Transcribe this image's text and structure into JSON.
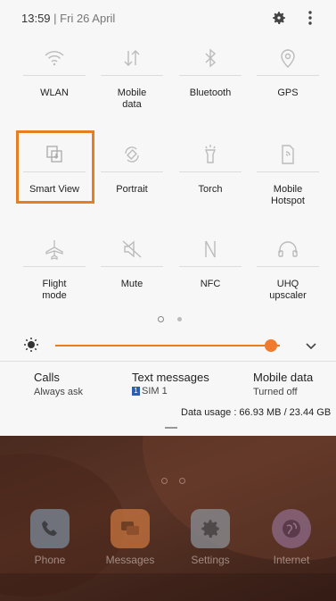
{
  "status": {
    "time": "13:59",
    "date": "Fri 26 April"
  },
  "tiles": [
    {
      "label": "WLAN",
      "icon": "wifi-icon"
    },
    {
      "label": "Mobile\ndata",
      "icon": "mobile-data-icon"
    },
    {
      "label": "Bluetooth",
      "icon": "bluetooth-icon"
    },
    {
      "label": "GPS",
      "icon": "location-pin-icon"
    },
    {
      "label": "Smart View",
      "icon": "smart-view-icon"
    },
    {
      "label": "Portrait",
      "icon": "rotate-icon"
    },
    {
      "label": "Torch",
      "icon": "torch-icon"
    },
    {
      "label": "Mobile\nHotspot",
      "icon": "hotspot-icon"
    },
    {
      "label": "Flight\nmode",
      "icon": "airplane-icon"
    },
    {
      "label": "Mute",
      "icon": "mute-icon"
    },
    {
      "label": "NFC",
      "icon": "nfc-icon"
    },
    {
      "label": "UHQ\nupscaler",
      "icon": "headphones-icon"
    }
  ],
  "brightness": {
    "level_fraction": 0.96,
    "accent": "#e67e22"
  },
  "info": {
    "calls_title": "Calls",
    "calls_sub": "Always ask",
    "text_title": "Text messages",
    "text_sim_badge": "1",
    "text_sub": "SIM  1",
    "data_title": "Mobile data",
    "data_sub": "Turned off",
    "usage": "Data usage : 66.93 MB / 23.44 GB"
  },
  "dock": [
    {
      "label": "Phone",
      "icon": "phone-icon",
      "color": "#7a8a99"
    },
    {
      "label": "Messages",
      "icon": "messages-icon",
      "color": "#c8753f"
    },
    {
      "label": "Settings",
      "icon": "settings-icon",
      "color": "#8a8f96"
    },
    {
      "label": "Internet",
      "icon": "internet-icon",
      "color": "#8f6b8a"
    }
  ]
}
